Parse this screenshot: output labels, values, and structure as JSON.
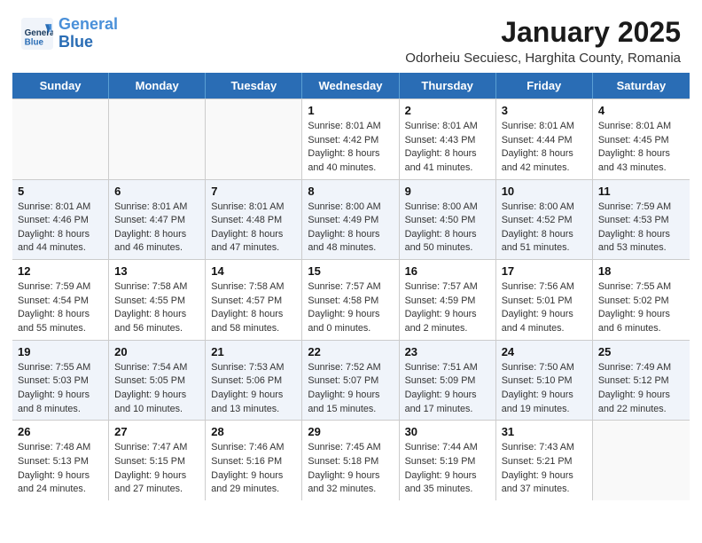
{
  "header": {
    "logo_line1": "General",
    "logo_line2": "Blue",
    "title": "January 2025",
    "subtitle": "Odorheiu Secuiesc, Harghita County, Romania"
  },
  "weekdays": [
    "Sunday",
    "Monday",
    "Tuesday",
    "Wednesday",
    "Thursday",
    "Friday",
    "Saturday"
  ],
  "rows": [
    [
      {
        "day": "",
        "detail": ""
      },
      {
        "day": "",
        "detail": ""
      },
      {
        "day": "",
        "detail": ""
      },
      {
        "day": "1",
        "detail": "Sunrise: 8:01 AM\nSunset: 4:42 PM\nDaylight: 8 hours and 40 minutes."
      },
      {
        "day": "2",
        "detail": "Sunrise: 8:01 AM\nSunset: 4:43 PM\nDaylight: 8 hours and 41 minutes."
      },
      {
        "day": "3",
        "detail": "Sunrise: 8:01 AM\nSunset: 4:44 PM\nDaylight: 8 hours and 42 minutes."
      },
      {
        "day": "4",
        "detail": "Sunrise: 8:01 AM\nSunset: 4:45 PM\nDaylight: 8 hours and 43 minutes."
      }
    ],
    [
      {
        "day": "5",
        "detail": "Sunrise: 8:01 AM\nSunset: 4:46 PM\nDaylight: 8 hours and 44 minutes."
      },
      {
        "day": "6",
        "detail": "Sunrise: 8:01 AM\nSunset: 4:47 PM\nDaylight: 8 hours and 46 minutes."
      },
      {
        "day": "7",
        "detail": "Sunrise: 8:01 AM\nSunset: 4:48 PM\nDaylight: 8 hours and 47 minutes."
      },
      {
        "day": "8",
        "detail": "Sunrise: 8:00 AM\nSunset: 4:49 PM\nDaylight: 8 hours and 48 minutes."
      },
      {
        "day": "9",
        "detail": "Sunrise: 8:00 AM\nSunset: 4:50 PM\nDaylight: 8 hours and 50 minutes."
      },
      {
        "day": "10",
        "detail": "Sunrise: 8:00 AM\nSunset: 4:52 PM\nDaylight: 8 hours and 51 minutes."
      },
      {
        "day": "11",
        "detail": "Sunrise: 7:59 AM\nSunset: 4:53 PM\nDaylight: 8 hours and 53 minutes."
      }
    ],
    [
      {
        "day": "12",
        "detail": "Sunrise: 7:59 AM\nSunset: 4:54 PM\nDaylight: 8 hours and 55 minutes."
      },
      {
        "day": "13",
        "detail": "Sunrise: 7:58 AM\nSunset: 4:55 PM\nDaylight: 8 hours and 56 minutes."
      },
      {
        "day": "14",
        "detail": "Sunrise: 7:58 AM\nSunset: 4:57 PM\nDaylight: 8 hours and 58 minutes."
      },
      {
        "day": "15",
        "detail": "Sunrise: 7:57 AM\nSunset: 4:58 PM\nDaylight: 9 hours and 0 minutes."
      },
      {
        "day": "16",
        "detail": "Sunrise: 7:57 AM\nSunset: 4:59 PM\nDaylight: 9 hours and 2 minutes."
      },
      {
        "day": "17",
        "detail": "Sunrise: 7:56 AM\nSunset: 5:01 PM\nDaylight: 9 hours and 4 minutes."
      },
      {
        "day": "18",
        "detail": "Sunrise: 7:55 AM\nSunset: 5:02 PM\nDaylight: 9 hours and 6 minutes."
      }
    ],
    [
      {
        "day": "19",
        "detail": "Sunrise: 7:55 AM\nSunset: 5:03 PM\nDaylight: 9 hours and 8 minutes."
      },
      {
        "day": "20",
        "detail": "Sunrise: 7:54 AM\nSunset: 5:05 PM\nDaylight: 9 hours and 10 minutes."
      },
      {
        "day": "21",
        "detail": "Sunrise: 7:53 AM\nSunset: 5:06 PM\nDaylight: 9 hours and 13 minutes."
      },
      {
        "day": "22",
        "detail": "Sunrise: 7:52 AM\nSunset: 5:07 PM\nDaylight: 9 hours and 15 minutes."
      },
      {
        "day": "23",
        "detail": "Sunrise: 7:51 AM\nSunset: 5:09 PM\nDaylight: 9 hours and 17 minutes."
      },
      {
        "day": "24",
        "detail": "Sunrise: 7:50 AM\nSunset: 5:10 PM\nDaylight: 9 hours and 19 minutes."
      },
      {
        "day": "25",
        "detail": "Sunrise: 7:49 AM\nSunset: 5:12 PM\nDaylight: 9 hours and 22 minutes."
      }
    ],
    [
      {
        "day": "26",
        "detail": "Sunrise: 7:48 AM\nSunset: 5:13 PM\nDaylight: 9 hours and 24 minutes."
      },
      {
        "day": "27",
        "detail": "Sunrise: 7:47 AM\nSunset: 5:15 PM\nDaylight: 9 hours and 27 minutes."
      },
      {
        "day": "28",
        "detail": "Sunrise: 7:46 AM\nSunset: 5:16 PM\nDaylight: 9 hours and 29 minutes."
      },
      {
        "day": "29",
        "detail": "Sunrise: 7:45 AM\nSunset: 5:18 PM\nDaylight: 9 hours and 32 minutes."
      },
      {
        "day": "30",
        "detail": "Sunrise: 7:44 AM\nSunset: 5:19 PM\nDaylight: 9 hours and 35 minutes."
      },
      {
        "day": "31",
        "detail": "Sunrise: 7:43 AM\nSunset: 5:21 PM\nDaylight: 9 hours and 37 minutes."
      },
      {
        "day": "",
        "detail": ""
      }
    ]
  ]
}
